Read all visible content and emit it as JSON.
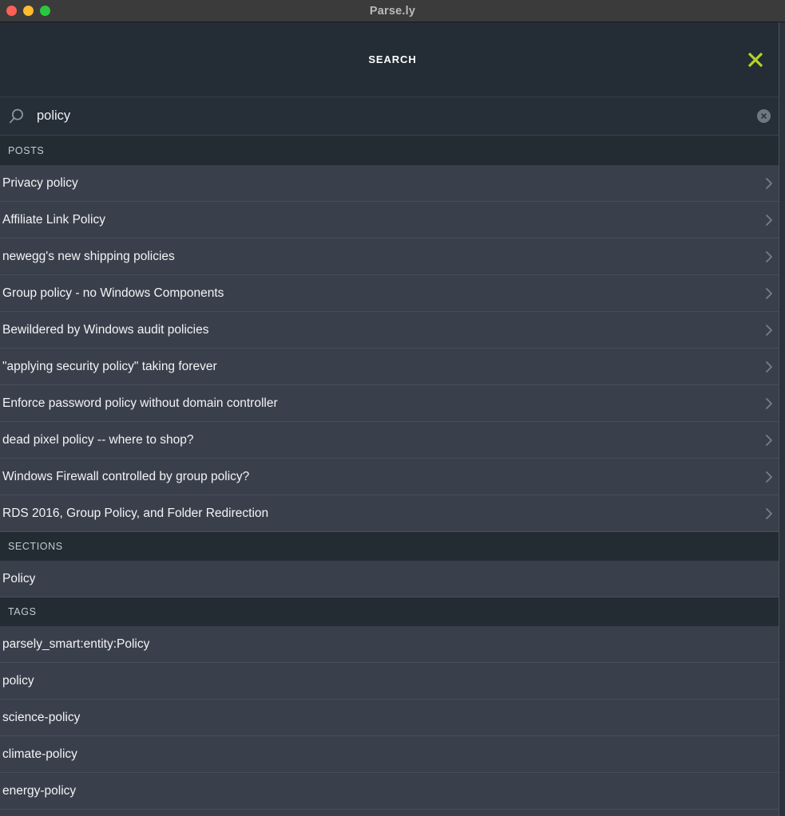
{
  "window": {
    "title": "Parse.ly",
    "controls": [
      {
        "name": "close",
        "color": "#ff5f57"
      },
      {
        "name": "minimize",
        "color": "#febc2e"
      },
      {
        "name": "maximize",
        "color": "#28c840"
      }
    ]
  },
  "header": {
    "title": "SEARCH",
    "close_icon": "close-x-icon",
    "close_color": "#b5d224"
  },
  "search": {
    "icon": "search-icon",
    "value": "policy",
    "placeholder": "Search",
    "clear_icon": "clear-circle-icon"
  },
  "sections": [
    {
      "header": "POSTS",
      "has_chevrons": true,
      "items": [
        {
          "label": "Privacy policy"
        },
        {
          "label": "Affiliate Link Policy"
        },
        {
          "label": "newegg's new shipping policies"
        },
        {
          "label": "Group policy - no Windows Components"
        },
        {
          "label": "Bewildered by Windows audit policies"
        },
        {
          "label": "\"applying security policy\" taking forever"
        },
        {
          "label": "Enforce password policy without domain controller"
        },
        {
          "label": "dead pixel policy -- where to shop?"
        },
        {
          "label": "Windows Firewall controlled by group policy?"
        },
        {
          "label": "RDS 2016, Group Policy, and Folder Redirection"
        }
      ]
    },
    {
      "header": "SECTIONS",
      "has_chevrons": false,
      "items": [
        {
          "label": "Policy"
        }
      ]
    },
    {
      "header": "TAGS",
      "has_chevrons": false,
      "items": [
        {
          "label": "parsely_smart:entity:Policy"
        },
        {
          "label": "policy"
        },
        {
          "label": "science-policy"
        },
        {
          "label": "climate-policy"
        },
        {
          "label": "energy-policy"
        }
      ]
    }
  ],
  "colors": {
    "titlebar_bg": "#3b3b3b",
    "header_bg": "#242d35",
    "searchrow_bg": "#262f38",
    "section_header_bg": "#242c33",
    "row_bg": "#3a404b",
    "accent_green": "#b5d224",
    "row_text": "#f2f4f6"
  }
}
